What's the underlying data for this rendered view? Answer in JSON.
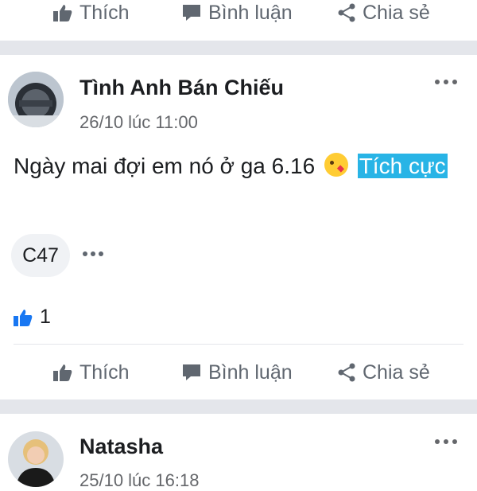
{
  "top_actions": {
    "like": "Thích",
    "comment": "Bình luận",
    "share": "Chia sẻ"
  },
  "post": {
    "author": "Tình Anh Bán Chiếu",
    "timestamp": "26/10 lúc 11:00",
    "text": "Ngày mai đợi em nó ở ga 6.16",
    "tag": "Tích cực",
    "chip": "C47",
    "like_count": "1",
    "actions": {
      "like": "Thích",
      "comment": "Bình luận",
      "share": "Chia sẻ"
    }
  },
  "next_post": {
    "author": "Natasha",
    "timestamp": "25/10 lúc 16:18"
  },
  "icons": [
    "like-icon",
    "comment-icon",
    "share-icon",
    "more-icon",
    "kiss-emoji-icon",
    "like-reaction-icon"
  ],
  "colors": {
    "tag_bg": "#28b4e6",
    "separator": "#e4e6eb",
    "action_text": "#606770",
    "like_blue": "#1877f2"
  }
}
